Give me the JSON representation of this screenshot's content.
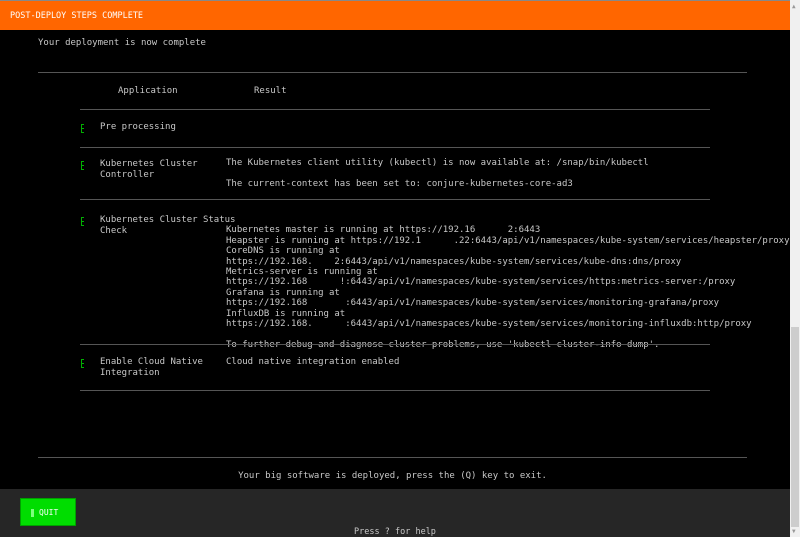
{
  "header": {
    "title": "POST-DEPLOY STEPS COMPLETE"
  },
  "intro": "Your deployment is now complete",
  "table": {
    "columns": [
      "Application",
      "Result"
    ],
    "rows": [
      {
        "status_icon": "check-box-icon",
        "application": [
          "Pre processing"
        ],
        "result": []
      },
      {
        "status_icon": "check-box-icon",
        "application": [
          "Kubernetes Cluster",
          "Controller"
        ],
        "result": [
          "The Kubernetes client utility (kubectl) is now available at: /snap/bin/kubectl",
          "",
          "The current-context has been set to: conjure-kubernetes-core-ad3"
        ]
      },
      {
        "status_icon": "check-box-icon",
        "application": [
          "Kubernetes Cluster Status",
          "Check"
        ],
        "result": [
          "Kubernetes master is running at https://192.16      2:6443",
          "Heapster is running at https://192.1      .22:6443/api/v1/namespaces/kube-system/services/heapster/proxy",
          "CoreDNS is running at",
          "https://192.168.    2:6443/api/v1/namespaces/kube-system/services/kube-dns:dns/proxy",
          "Metrics-server is running at",
          "https://192.168      !:6443/api/v1/namespaces/kube-system/services/https:metrics-server:/proxy",
          "Grafana is running at",
          "https://192.168       :6443/api/v1/namespaces/kube-system/services/monitoring-grafana/proxy",
          "InfluxDB is running at",
          "https://192.168.      :6443/api/v1/namespaces/kube-system/services/monitoring-influxdb:http/proxy",
          "",
          "To further debug and diagnose cluster problems, use 'kubectl cluster-info dump'."
        ]
      },
      {
        "status_icon": "check-box-icon",
        "application": [
          "Enable Cloud Native",
          "Integration"
        ],
        "result": [
          "Cloud native integration enabled"
        ]
      }
    ]
  },
  "summary": "Your big software is deployed, press the (Q) key to exit.",
  "footer": {
    "quit_label": "QUIT",
    "help": "Press ? for help"
  },
  "colors": {
    "header": "#ff6600",
    "quit_button": "#00dd00",
    "status_icon": "#00b000",
    "footer": "#262626"
  }
}
